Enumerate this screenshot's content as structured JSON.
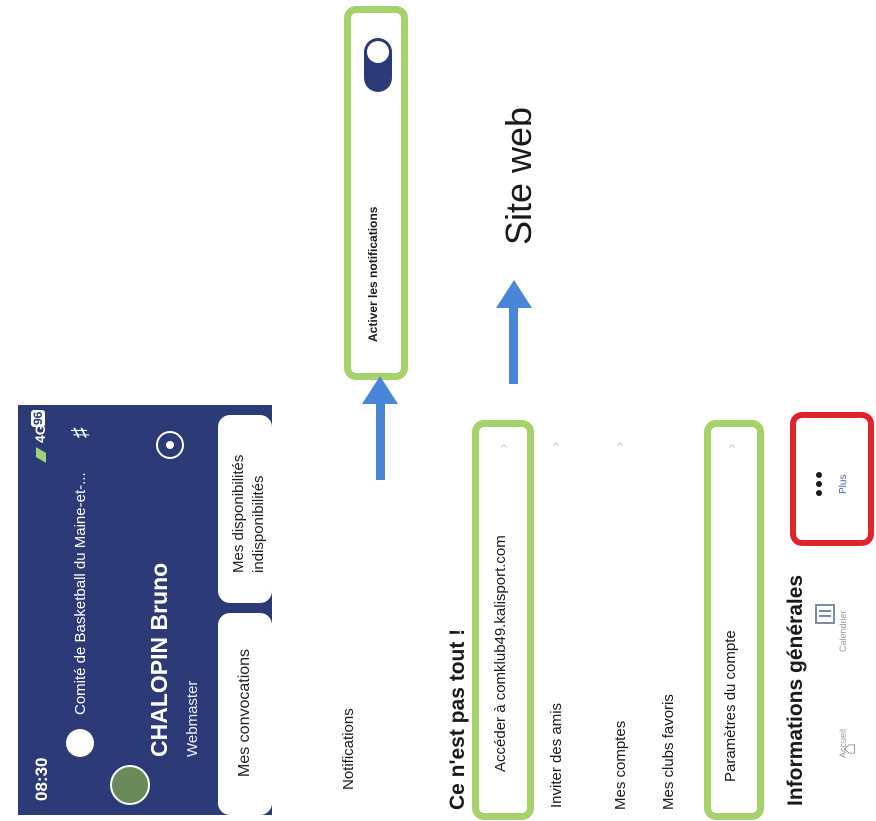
{
  "status_bar": {
    "time": "08:30",
    "network": "4G",
    "battery": "96"
  },
  "profile": {
    "club": "Comité de Basketball du Maine-et-...",
    "name": "CHALOPIN Bruno",
    "role": "Webmaster"
  },
  "tabs": [
    {
      "label": "Mes convocations"
    },
    {
      "label_line1": "Mes disponibilités",
      "label_line2": "indisponibilités"
    }
  ],
  "menu": {
    "notifications": "Notifications",
    "section_title": "Ce n'est pas tout !",
    "access_site": "Accéder à comklub49.kalisport.com",
    "invite": "Inviter des amis",
    "accounts": "Mes comptes",
    "favorites": "Mes clubs favoris",
    "settings": "Paramètres du compte",
    "info_title": "Informations générales"
  },
  "notification_toggle": {
    "label": "Activer les notifications",
    "enabled": true
  },
  "annotation": {
    "site_label": "Site web"
  },
  "bottom_nav": [
    {
      "label": "Accueil",
      "icon": "home-icon"
    },
    {
      "label": "Calendrier",
      "icon": "calendar-icon"
    },
    {
      "label": "Plus",
      "icon": "more-icon"
    }
  ],
  "colors": {
    "header": "#2d3a78",
    "highlight_green": "#a7d169",
    "highlight_red": "#e0242c",
    "arrow": "#4a86d8"
  }
}
